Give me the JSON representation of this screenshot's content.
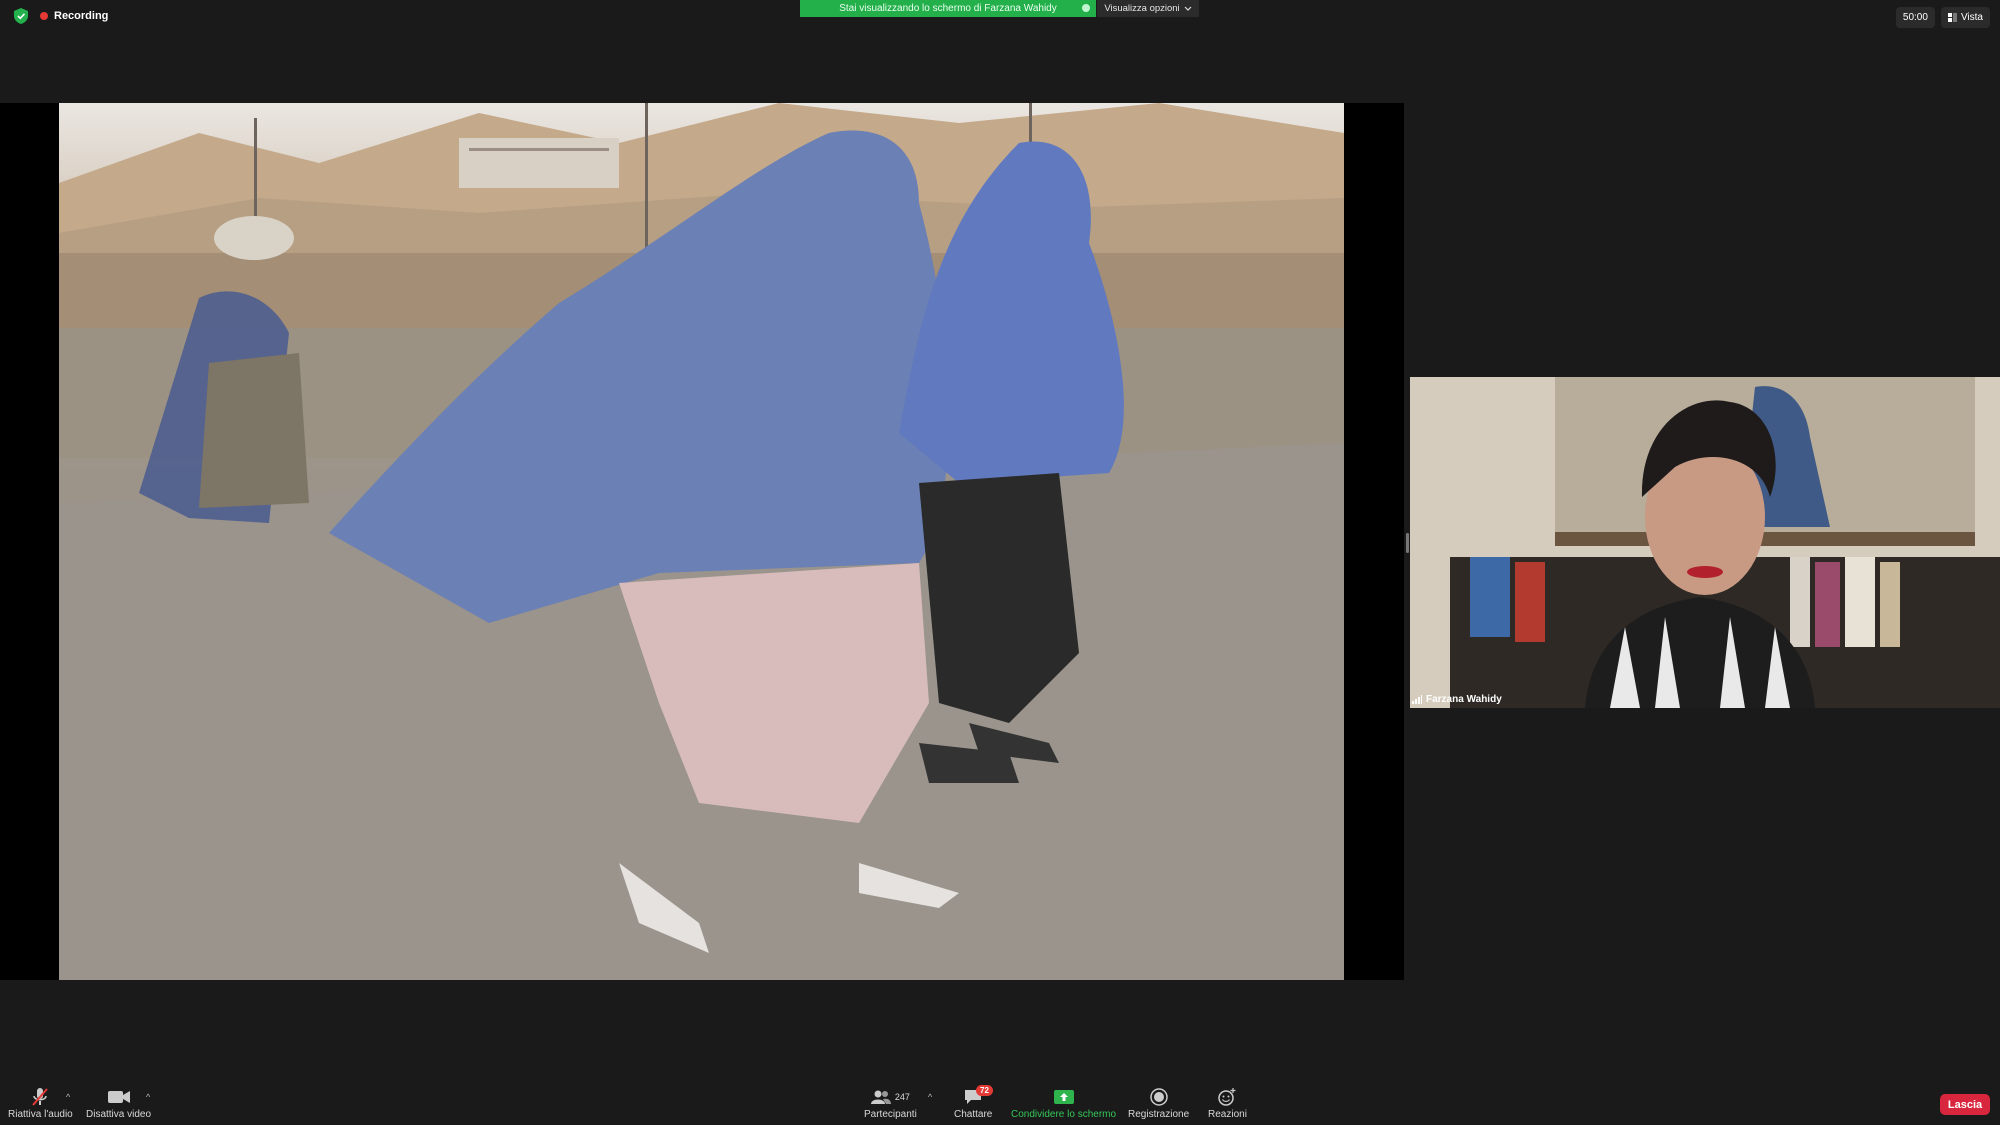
{
  "top": {
    "recording_label": "Recording",
    "banner_text": "Stai visualizzando lo schermo di Farzana Wahidy",
    "view_options_label": "Visualizza opzioni",
    "timer": "50:00",
    "view_label": "Vista"
  },
  "participant": {
    "name": "Farzana Wahidy"
  },
  "toolbar": {
    "unmute_label": "Riattiva l'audio",
    "video_label": "Disattiva video",
    "participants_label": "Partecipanti",
    "participants_count": "247",
    "chat_label": "Chattare",
    "chat_badge": "72",
    "share_label": "Condividere lo schermo",
    "record_label": "Registrazione",
    "reactions_label": "Reazioni",
    "leave_label": "Lascia"
  },
  "colors": {
    "share_green": "#23b04a",
    "leave_red": "#d7263d",
    "recording_red": "#e53935",
    "burqa_blue": "#6b80b4"
  },
  "icons": [
    "shield-icon",
    "record-dot-icon",
    "chevron-down-icon",
    "grid-icon",
    "signal-icon",
    "mic-off-icon",
    "camera-icon",
    "participants-icon",
    "chat-icon",
    "share-screen-icon",
    "record-icon",
    "reactions-icon"
  ]
}
